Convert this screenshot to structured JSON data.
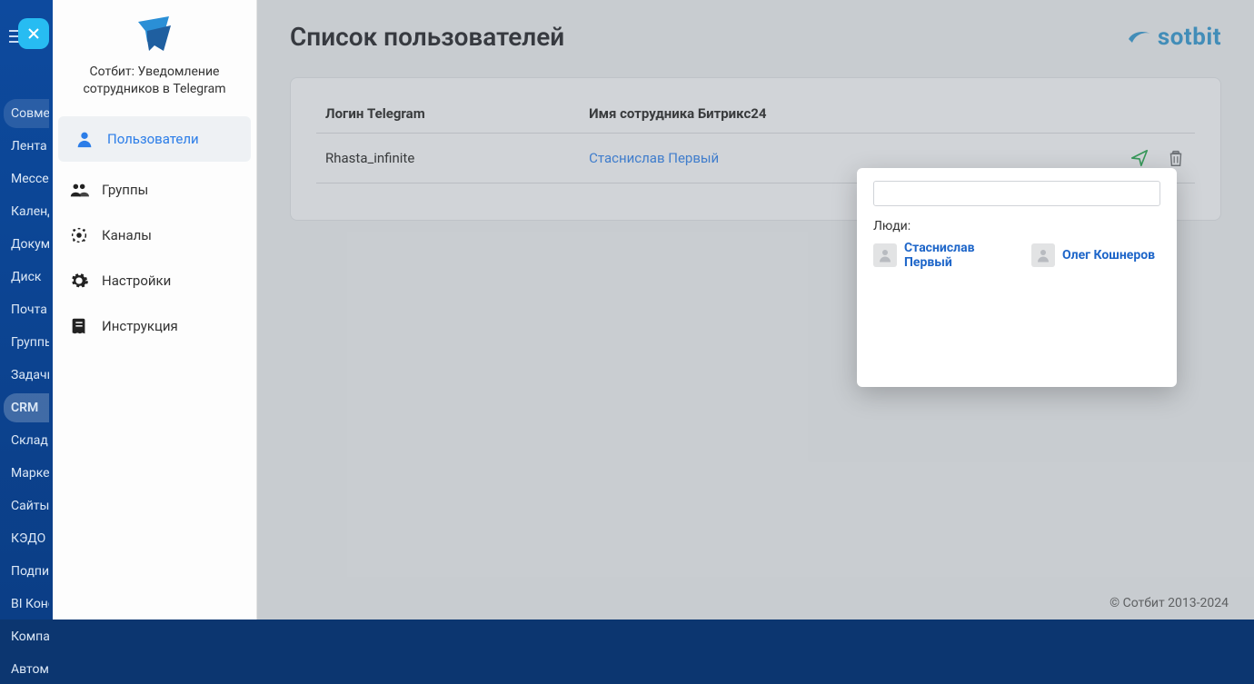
{
  "bitrix_rail": {
    "close_button_label": "×",
    "items": [
      {
        "label": "Совместная работа",
        "pill": true
      },
      {
        "label": "Лента"
      },
      {
        "label": "Мессенджер"
      },
      {
        "label": "Календарь"
      },
      {
        "label": "Документы"
      },
      {
        "label": "Диск"
      },
      {
        "label": "Почта"
      },
      {
        "label": "Группы"
      },
      {
        "label": "Задачи и Проекты"
      },
      {
        "label": "CRM",
        "active": true,
        "pill": true
      },
      {
        "label": "Склад"
      },
      {
        "label": "Маркетинг"
      },
      {
        "label": "Сайты"
      },
      {
        "label": "КЭДО"
      },
      {
        "label": "Подписи"
      },
      {
        "label": "BI Конструктор"
      },
      {
        "label": "Компания"
      },
      {
        "label": "Автоматизация"
      }
    ]
  },
  "module_sidebar": {
    "title": "Сотбит: Уведомление сотрудников в Telegram",
    "items": [
      {
        "icon": "user",
        "label": "Пользователи",
        "active": true
      },
      {
        "icon": "users",
        "label": "Группы"
      },
      {
        "icon": "channel",
        "label": "Каналы"
      },
      {
        "icon": "gear",
        "label": "Настройки"
      },
      {
        "icon": "book",
        "label": "Инструкция"
      }
    ]
  },
  "page": {
    "title": "Список пользователей",
    "brand_word": "sotbit"
  },
  "table": {
    "col_login": "Логин Telegram",
    "col_name": "Имя сотрудника Битрикс24",
    "rows": [
      {
        "login": "Rhasta_infinite",
        "name": "Стаснислав Первый"
      }
    ]
  },
  "popup": {
    "search_placeholder": "",
    "people_label": "Люди:",
    "people": [
      {
        "name": "Стаснислав Первый"
      },
      {
        "name": "Олег Кошнеров"
      }
    ]
  },
  "footer": {
    "copyright": "© Сотбит 2013-2024"
  }
}
